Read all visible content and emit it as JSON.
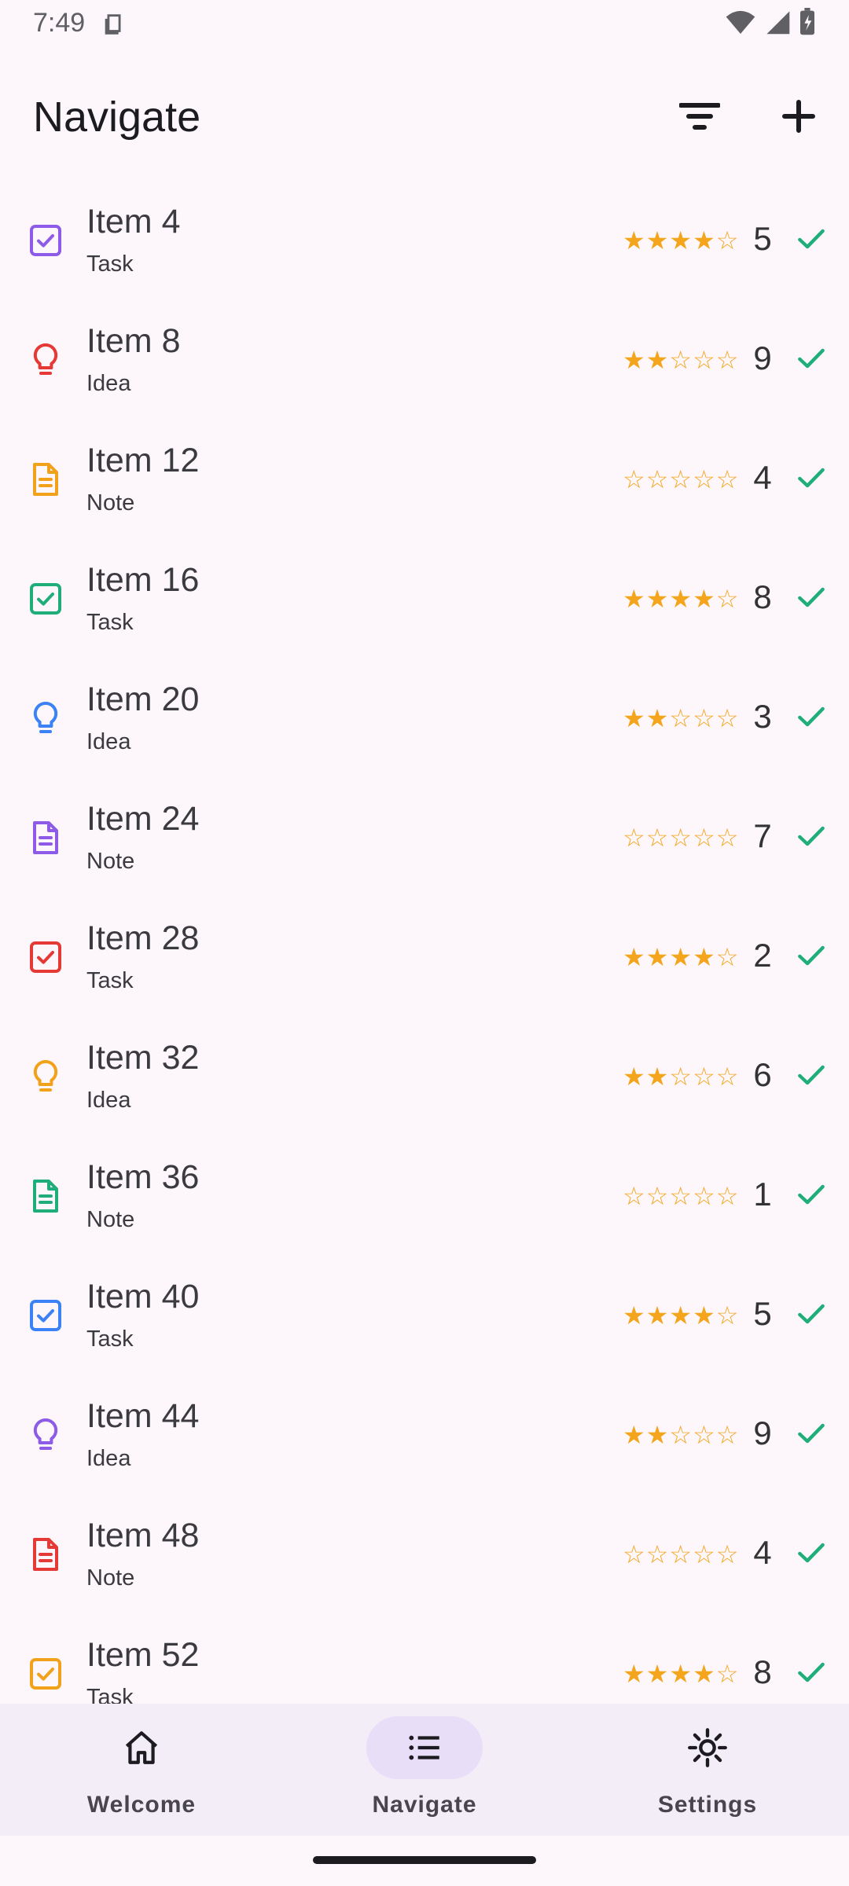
{
  "status": {
    "time": "7:49"
  },
  "appbar": {
    "title": "Navigate"
  },
  "colors": {
    "purple": "#8e5be8",
    "red": "#e53935",
    "orange": "#f2a21a",
    "green": "#1fae7a",
    "blue": "#3b82f6",
    "star": "#f4a51c",
    "check": "#1fae7a"
  },
  "items": [
    {
      "title": "Item 4",
      "type": "Task",
      "icon": "checkbox-icon",
      "color": "#8e5be8",
      "stars": "★★★★☆",
      "count": "5"
    },
    {
      "title": "Item 8",
      "type": "Idea",
      "icon": "lightbulb-icon",
      "color": "#e53935",
      "stars": "★★☆☆☆",
      "count": "9"
    },
    {
      "title": "Item 12",
      "type": "Note",
      "icon": "document-icon",
      "color": "#f2a21a",
      "stars": "☆☆☆☆☆",
      "count": "4"
    },
    {
      "title": "Item 16",
      "type": "Task",
      "icon": "checkbox-icon",
      "color": "#1fae7a",
      "stars": "★★★★☆",
      "count": "8"
    },
    {
      "title": "Item 20",
      "type": "Idea",
      "icon": "lightbulb-icon",
      "color": "#3b82f6",
      "stars": "★★☆☆☆",
      "count": "3"
    },
    {
      "title": "Item 24",
      "type": "Note",
      "icon": "document-icon",
      "color": "#8e5be8",
      "stars": "☆☆☆☆☆",
      "count": "7"
    },
    {
      "title": "Item 28",
      "type": "Task",
      "icon": "checkbox-icon",
      "color": "#e53935",
      "stars": "★★★★☆",
      "count": "2"
    },
    {
      "title": "Item 32",
      "type": "Idea",
      "icon": "lightbulb-icon",
      "color": "#f2a21a",
      "stars": "★★☆☆☆",
      "count": "6"
    },
    {
      "title": "Item 36",
      "type": "Note",
      "icon": "document-icon",
      "color": "#1fae7a",
      "stars": "☆☆☆☆☆",
      "count": "1"
    },
    {
      "title": "Item 40",
      "type": "Task",
      "icon": "checkbox-icon",
      "color": "#3b82f6",
      "stars": "★★★★☆",
      "count": "5"
    },
    {
      "title": "Item 44",
      "type": "Idea",
      "icon": "lightbulb-icon",
      "color": "#8e5be8",
      "stars": "★★☆☆☆",
      "count": "9"
    },
    {
      "title": "Item 48",
      "type": "Note",
      "icon": "document-icon",
      "color": "#e53935",
      "stars": "☆☆☆☆☆",
      "count": "4"
    },
    {
      "title": "Item 52",
      "type": "Task",
      "icon": "checkbox-icon",
      "color": "#f2a21a",
      "stars": "★★★★☆",
      "count": "8"
    }
  ],
  "nav": {
    "items": [
      {
        "label": "Welcome",
        "icon": "home-icon"
      },
      {
        "label": "Navigate",
        "icon": "list-icon",
        "active": true
      },
      {
        "label": "Settings",
        "icon": "settings-icon"
      }
    ]
  }
}
